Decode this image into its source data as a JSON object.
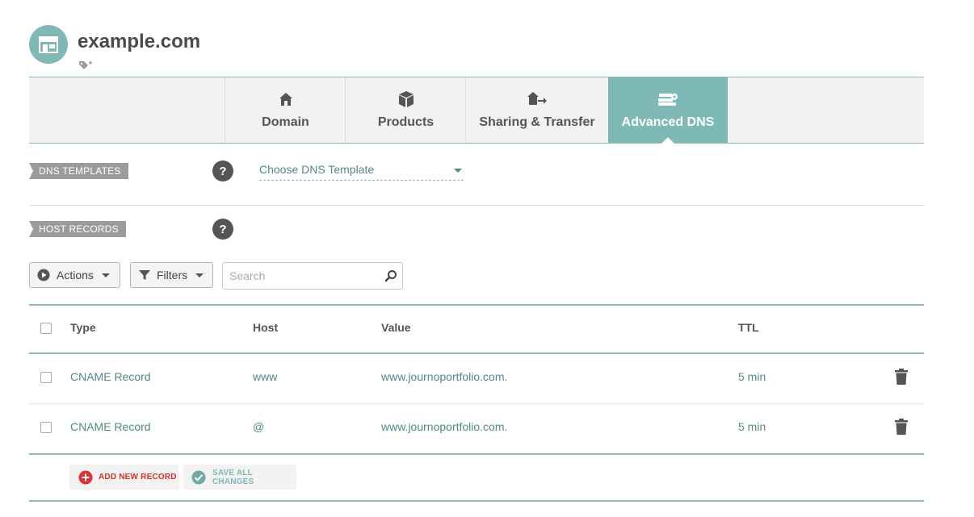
{
  "header": {
    "domain_name": "example.com",
    "avatar_icon": "storefront-icon",
    "tag_icon": "tag-add-icon"
  },
  "tabs": [
    {
      "label": "Domain",
      "icon": "home-icon",
      "active": false
    },
    {
      "label": "Products",
      "icon": "box-icon",
      "active": false
    },
    {
      "label": "Sharing & Transfer",
      "icon": "home-transfer-icon",
      "active": false
    },
    {
      "label": "Advanced DNS",
      "icon": "server-gear-icon",
      "active": true
    }
  ],
  "dns_templates": {
    "label": "DNS TEMPLATES",
    "help": "?",
    "select_value": "Choose DNS Template"
  },
  "host_records": {
    "label": "HOST RECORDS",
    "help": "?"
  },
  "toolbar": {
    "actions_label": "Actions",
    "filters_label": "Filters",
    "search_placeholder": "Search"
  },
  "table": {
    "columns": [
      "Type",
      "Host",
      "Value",
      "TTL"
    ],
    "rows": [
      {
        "type": "CNAME Record",
        "host": "www",
        "value": "www.journoportfolio.com.",
        "ttl": "5 min"
      },
      {
        "type": "CNAME Record",
        "host": "@",
        "value": "www.journoportfolio.com.",
        "ttl": "5 min"
      }
    ]
  },
  "footer": {
    "add_label": "ADD NEW RECORD",
    "save_label": "SAVE ALL CHANGES"
  },
  "colors": {
    "accent": "#7fb9b5",
    "teal_text": "#4f8a86",
    "add_red": "#e03131"
  }
}
